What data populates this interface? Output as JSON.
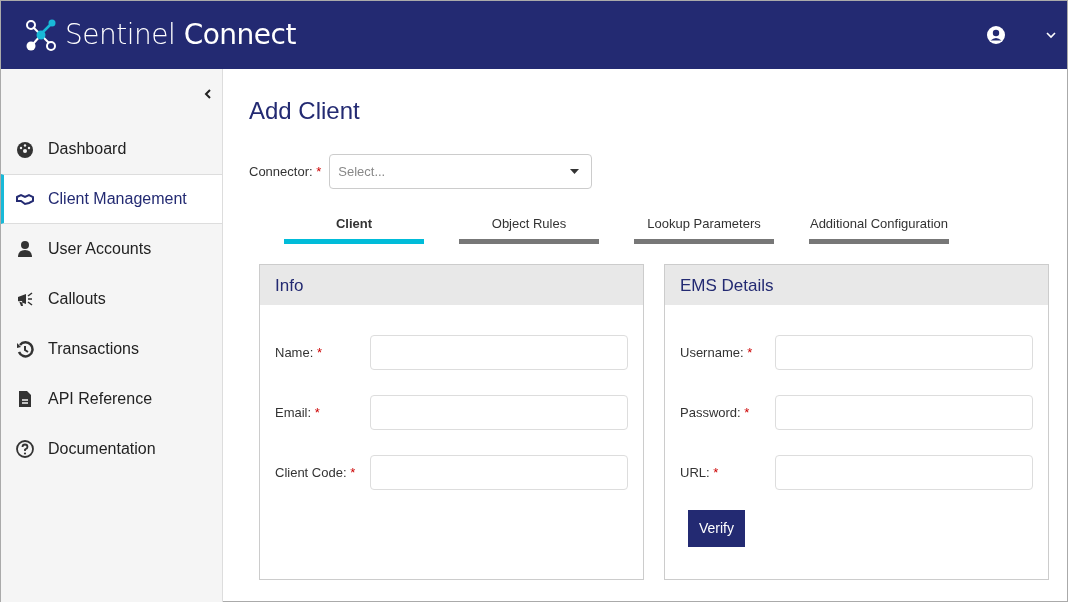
{
  "header": {
    "brand_first": "Sentinel",
    "brand_second": "Connect"
  },
  "sidebar": {
    "items": [
      {
        "label": "Dashboard",
        "selected": false
      },
      {
        "label": "Client Management",
        "selected": true
      },
      {
        "label": "User Accounts",
        "selected": false
      },
      {
        "label": "Callouts",
        "selected": false
      },
      {
        "label": "Transactions",
        "selected": false
      },
      {
        "label": "API Reference",
        "selected": false
      },
      {
        "label": "Documentation",
        "selected": false
      }
    ]
  },
  "page_title": "Add Client",
  "connector": {
    "label": "Connector:",
    "mark": "*",
    "placeholder": "Select..."
  },
  "tabs": [
    {
      "label": "Client",
      "selected": true
    },
    {
      "label": "Object Rules",
      "selected": false
    },
    {
      "label": "Lookup Parameters",
      "selected": false
    },
    {
      "label": "Additional Configuration",
      "selected": false
    }
  ],
  "panels": [
    {
      "title": "Info",
      "fields": [
        {
          "label": "Name:",
          "mark": "*"
        },
        {
          "label": "Email:",
          "mark": "*"
        },
        {
          "label": "Client Code:",
          "mark": "*"
        }
      ]
    },
    {
      "title": "EMS Details",
      "fields": [
        {
          "label": "Username:",
          "mark": "*"
        },
        {
          "label": "Password:",
          "mark": "*"
        },
        {
          "label": "URL:",
          "mark": "*"
        }
      ],
      "button": "Verify"
    }
  ]
}
